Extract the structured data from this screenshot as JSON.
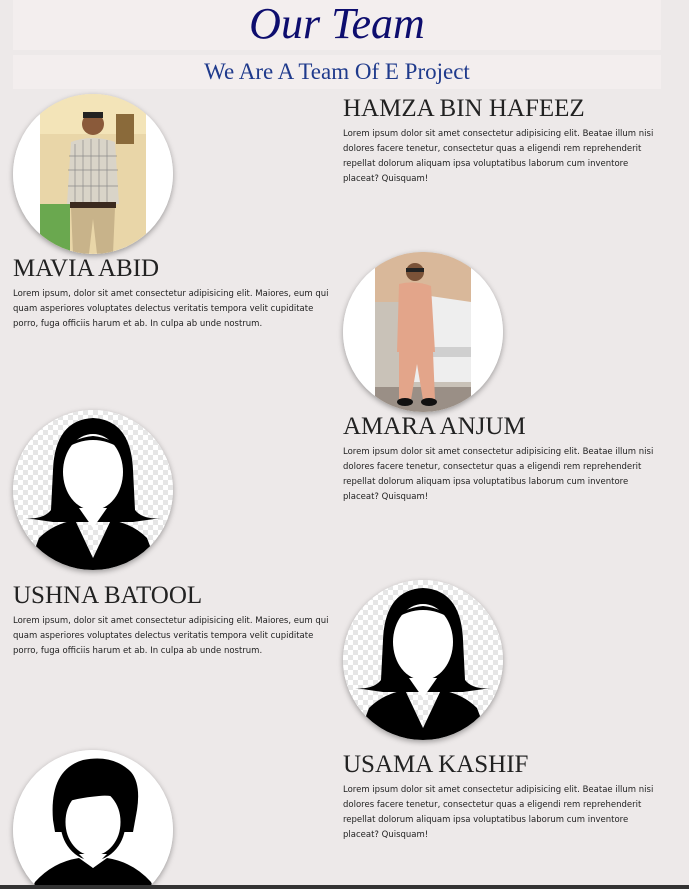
{
  "header": {
    "title": "Our Team",
    "subtitle": "We Are A Team Of E Project"
  },
  "members": [
    {
      "name": "HAMZA BIN HAFEEZ",
      "description": "Lorem ipsum dolor sit amet consectetur adipisicing elit. Beatae illum nisi dolores facere tenetur, consectetur quas a eligendi rem reprehenderit repellat dolorum aliquam ipsa voluptatibus laborum cum inventore placeat? Quisquam!",
      "avatar": "photo-man-checked-shirt"
    },
    {
      "name": "MAVIA ABID",
      "description": "Lorem ipsum, dolor sit amet consectetur adipisicing elit. Maiores, eum qui quam asperiores voluptates delectus veritatis tempora velit cupiditate porro, fuga officiis harum et ab. In culpa ab unde nostrum.",
      "avatar": "photo-man-car"
    },
    {
      "name": "AMARA ANJUM",
      "description": "Lorem ipsum dolor sit amet consectetur adipisicing elit. Beatae illum nisi dolores facere tenetur, consectetur quas a eligendi rem reprehenderit repellat dolorum aliquam ipsa voluptatibus laborum cum inventore placeat? Quisquam!",
      "avatar": "female-silhouette-icon"
    },
    {
      "name": "USHNA BATOOL",
      "description": "Lorem ipsum, dolor sit amet consectetur adipisicing elit. Maiores, eum qui quam asperiores voluptates delectus veritatis tempora velit cupiditate porro, fuga officiis harum et ab. In culpa ab unde nostrum.",
      "avatar": "female-silhouette-icon"
    },
    {
      "name": "USAMA KASHIF",
      "description": "Lorem ipsum dolor sit amet consectetur adipisicing elit. Beatae illum nisi dolores facere tenetur, consectetur quas a eligendi rem reprehenderit repellat dolorum aliquam ipsa voluptatibus laborum cum inventore placeat? Quisquam!",
      "avatar": "male-silhouette-icon"
    }
  ]
}
